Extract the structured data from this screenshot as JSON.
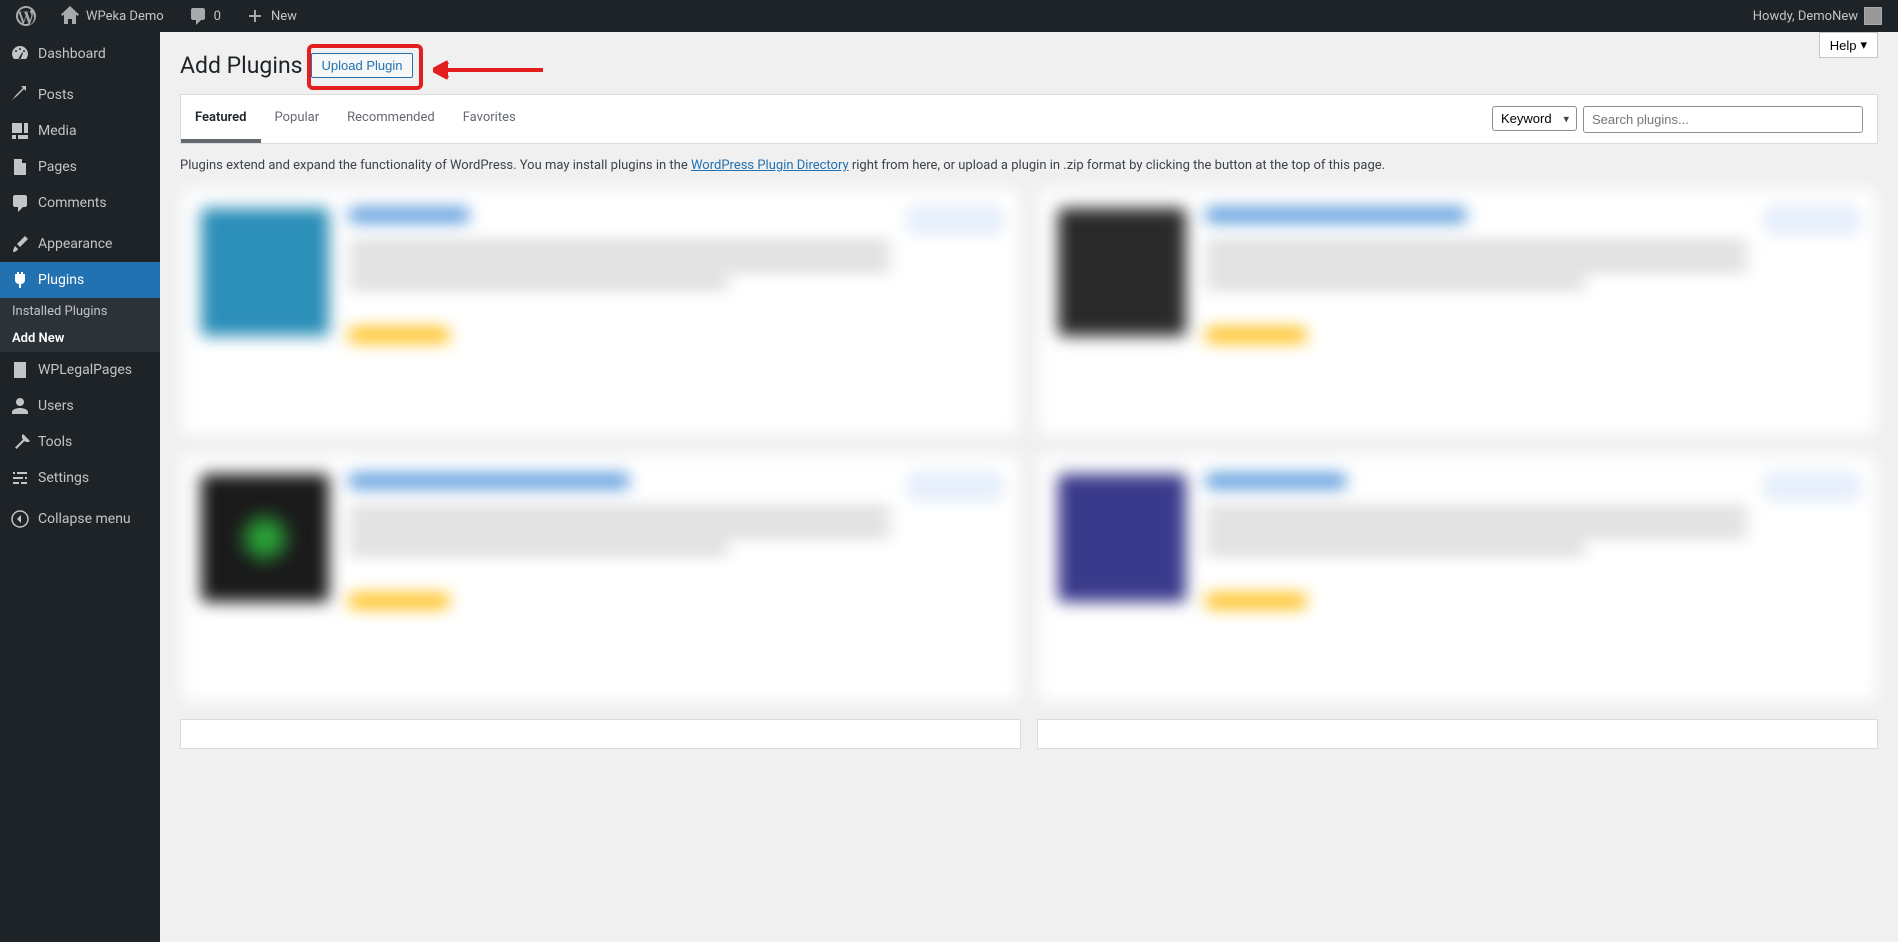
{
  "adminbar": {
    "site_name": "WPeka Demo",
    "comments_count": "0",
    "new_label": "New",
    "howdy": "Howdy, DemoNew"
  },
  "sidebar": {
    "items": [
      {
        "label": "Dashboard"
      },
      {
        "label": "Posts"
      },
      {
        "label": "Media"
      },
      {
        "label": "Pages"
      },
      {
        "label": "Comments"
      },
      {
        "label": "Appearance"
      },
      {
        "label": "Plugins"
      },
      {
        "label": "WPLegalPages"
      },
      {
        "label": "Users"
      },
      {
        "label": "Tools"
      },
      {
        "label": "Settings"
      },
      {
        "label": "Collapse menu"
      }
    ],
    "submenu": {
      "installed": "Installed Plugins",
      "add_new": "Add New"
    }
  },
  "page": {
    "title": "Add Plugins",
    "upload_button": "Upload Plugin",
    "help_button": "Help",
    "description_prefix": "Plugins extend and expand the functionality of WordPress. You may install plugins in the ",
    "description_link": "WordPress Plugin Directory",
    "description_suffix": " right from here, or upload a plugin in .zip format by clicking the button at the top of this page."
  },
  "filter": {
    "tabs": [
      "Featured",
      "Popular",
      "Recommended",
      "Favorites"
    ],
    "keyword_label": "Keyword",
    "search_placeholder": "Search plugins..."
  }
}
